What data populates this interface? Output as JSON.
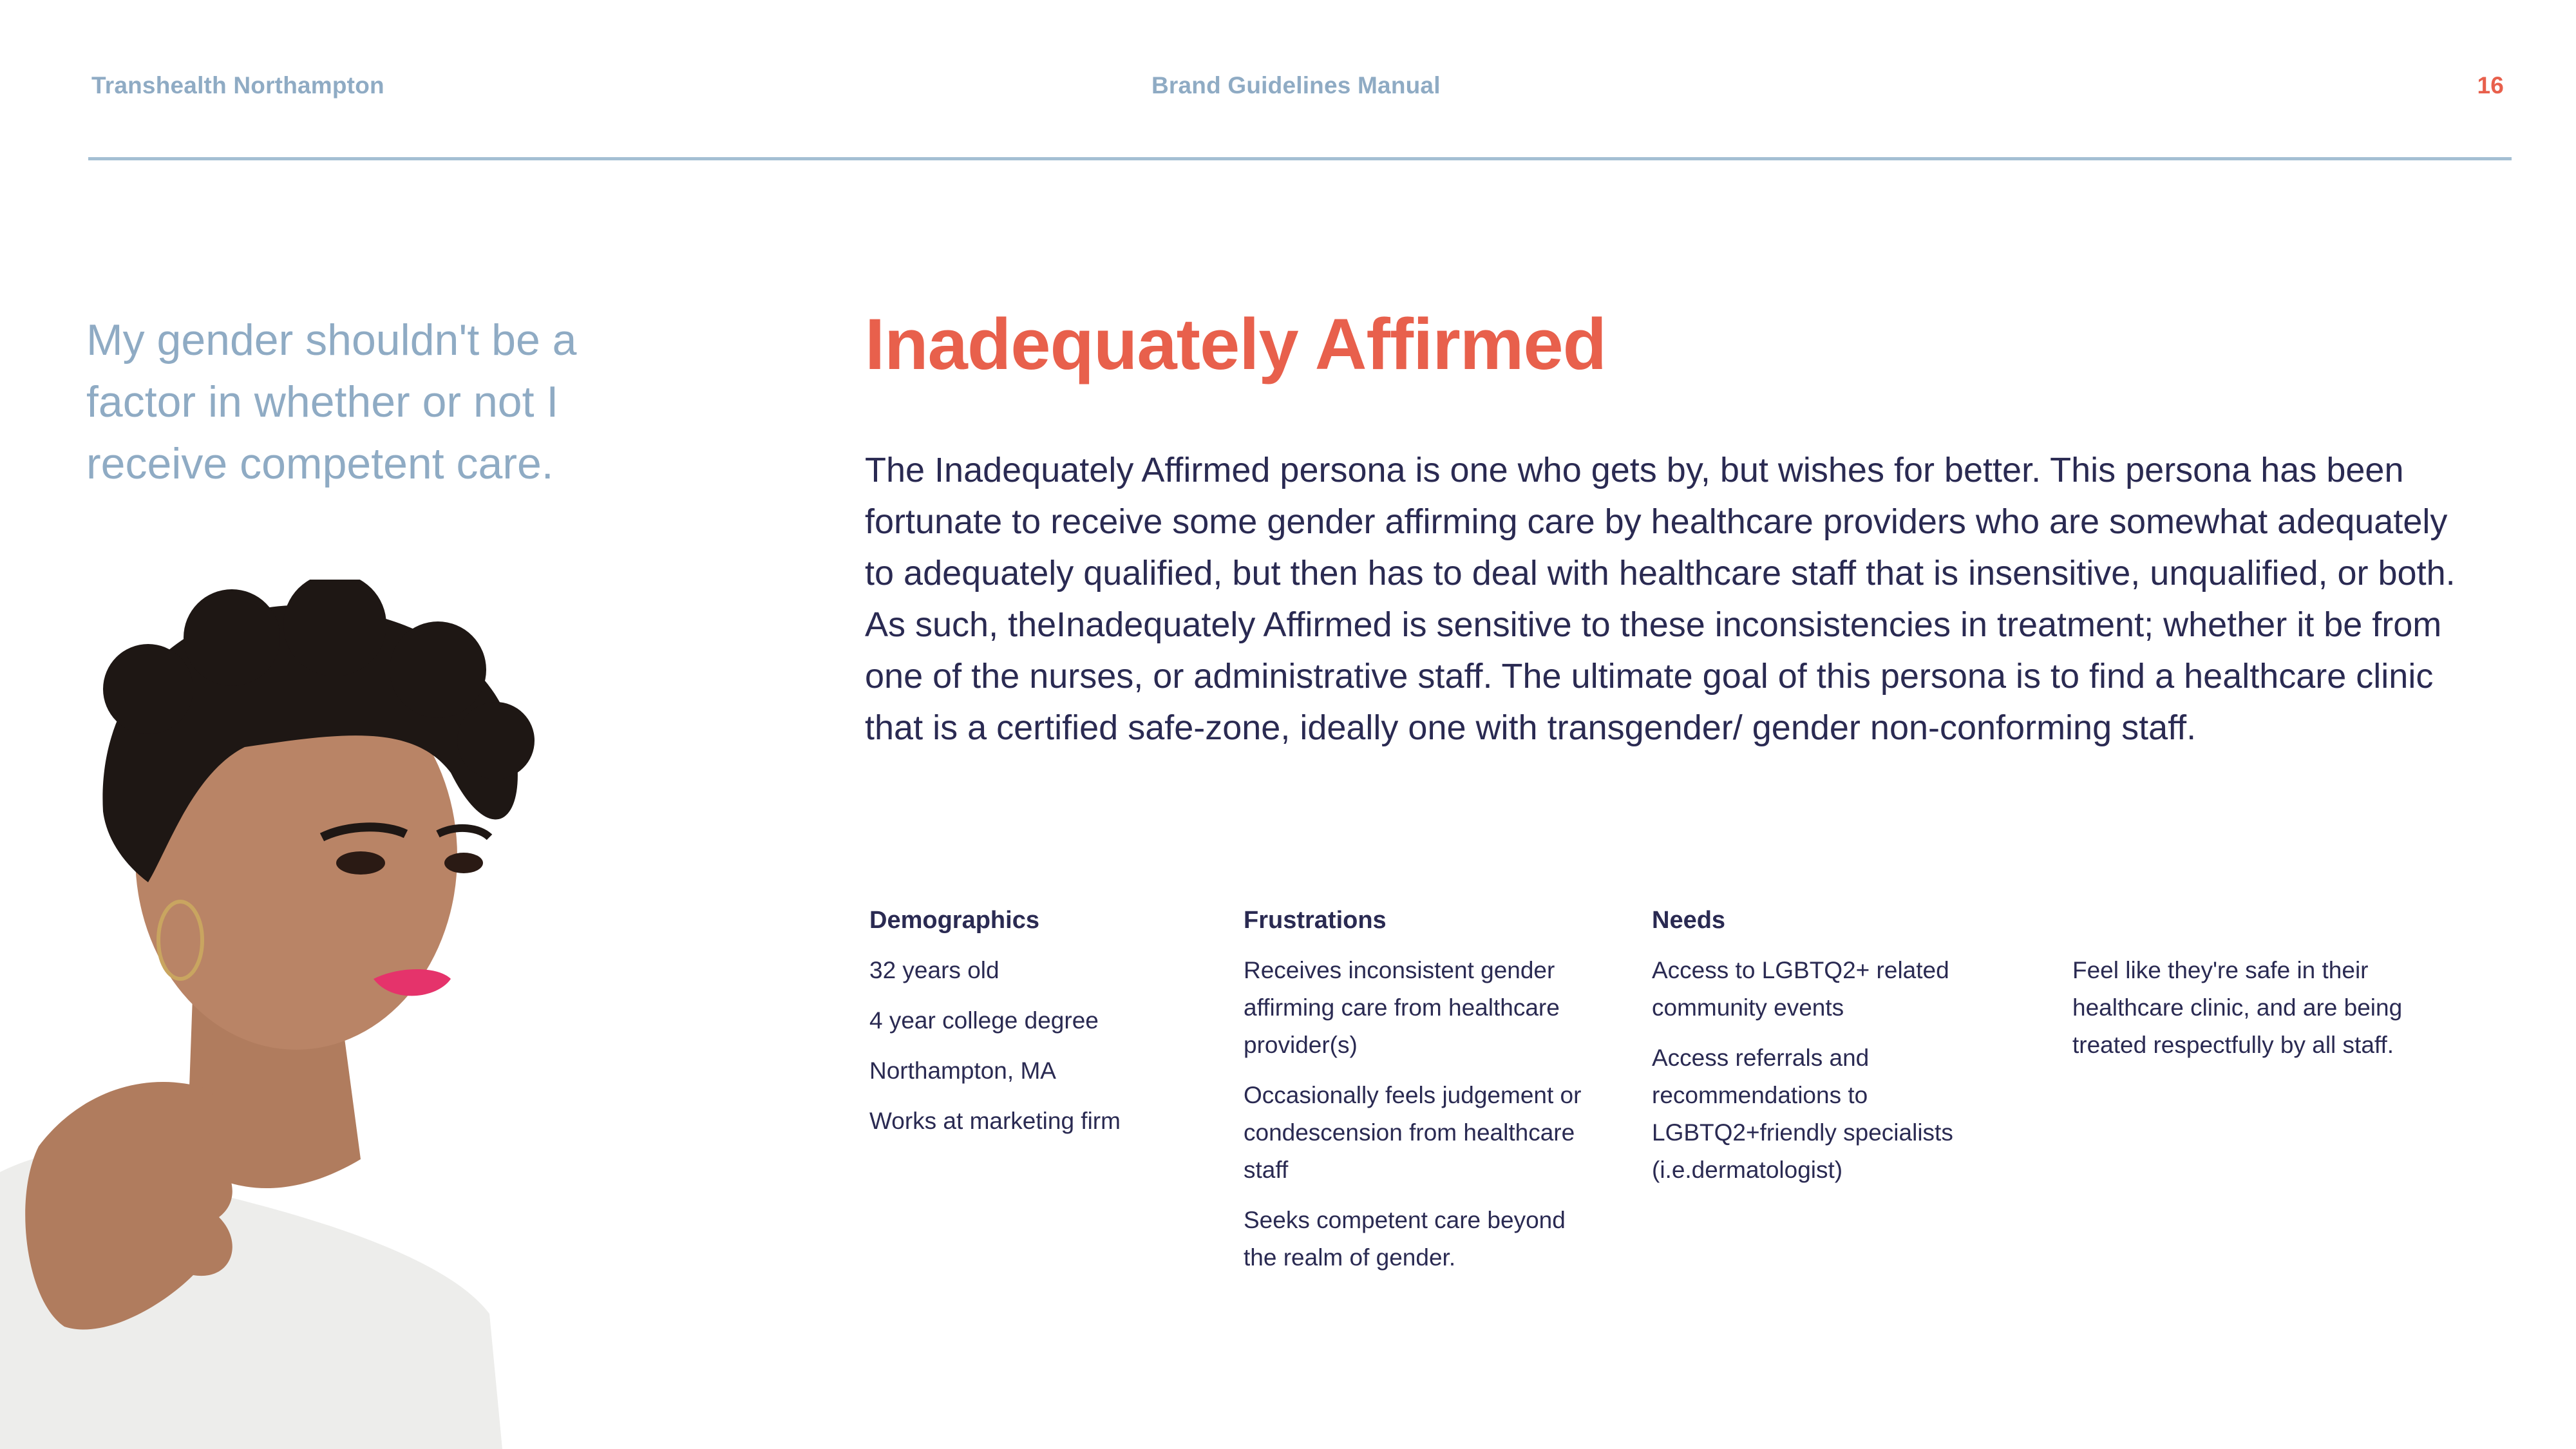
{
  "header": {
    "organization": "Transhealth Northampton",
    "document": "Brand Guidelines Manual",
    "page_number": "16"
  },
  "quote": "My gender shouldn't be a factor in whether or not I receive competent care.",
  "persona": {
    "title": "Inadequately Affirmed",
    "description": "The Inadequately Affirmed persona is one who gets by, but wishes for better. This persona has been fortunate to receive some gender affirming care by healthcare providers who are somewhat adequately to adequately qualified, but then has to deal with healthcare staff that is insensitive, unqualified, or both. As such, theInadequately Affirmed is sensitive to these inconsistencies in treatment; whether it be from one of the nurses, or administrative staff. The ultimate goal of this persona is to find a healthcare clinic that is a certified safe-zone, ideally one with transgender/ gender non-conforming staff."
  },
  "demographics": {
    "heading": "Demographics",
    "items": [
      "32 years old",
      "4 year college degree",
      "Northampton, MA",
      "Works at marketing firm"
    ]
  },
  "frustrations": {
    "heading": "Frustrations",
    "items": [
      "Receives inconsistent gender affirming care from healthcare provider(s)",
      "Occasionally feels judgement or condescension from healthcare staff",
      "Seeks competent care beyond the realm of gender."
    ]
  },
  "needs": {
    "heading": "Needs",
    "items": [
      "Access to LGBTQ2+ related community events",
      "Access referrals and recommendations to LGBTQ2+friendly specialists (i.e.dermatologist)"
    ],
    "extra": [
      "Feel like they're safe in their healthcare clinic, and are being treated respectfully by all staff."
    ]
  },
  "colors": {
    "accent": "#e8604c",
    "muted_blue": "#8fabc4",
    "body_text": "#2a2a52"
  }
}
